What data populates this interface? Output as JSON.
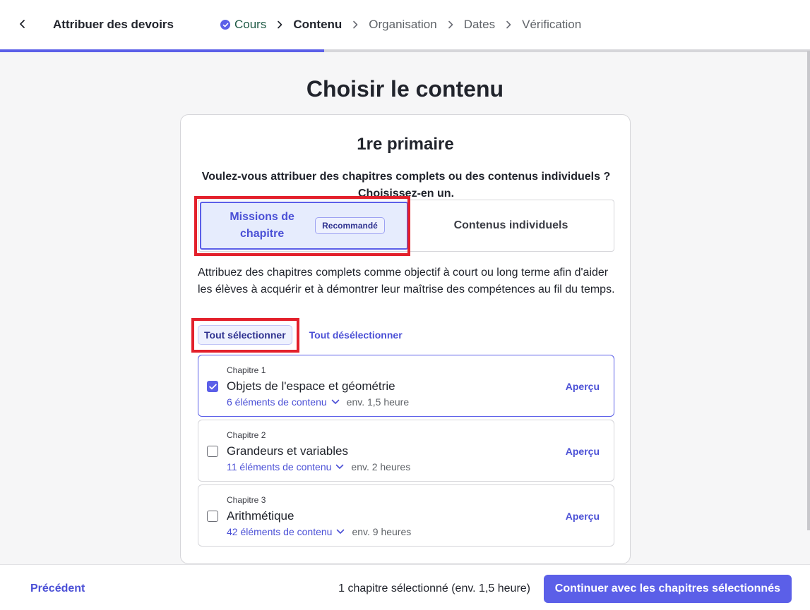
{
  "header": {
    "title": "Attribuer des devoirs",
    "steps": [
      {
        "label": "Cours",
        "state": "done"
      },
      {
        "label": "Contenu",
        "state": "current"
      },
      {
        "label": "Organisation",
        "state": "upcoming"
      },
      {
        "label": "Dates",
        "state": "upcoming"
      },
      {
        "label": "Vérification",
        "state": "upcoming"
      }
    ],
    "progress_fraction": 0.4
  },
  "page": {
    "title": "Choisir le contenu"
  },
  "card": {
    "course": "1re primaire",
    "question": "Voulez-vous attribuer des chapitres complets ou des contenus individuels ? Choisissez-en un.",
    "options": {
      "missions": "Missions de chapitre",
      "recommended_badge": "Recommandé",
      "individual": "Contenus individuels"
    },
    "description": "Attribuez des chapitres complets comme objectif à court ou long terme afin d'aider les élèves à acquérir et à démontrer leur maîtrise des compétences au fil du temps.",
    "select_all": "Tout sélectionner",
    "deselect_all": "Tout désélectionner",
    "chapters": [
      {
        "number": "Chapitre 1",
        "title": "Objets de l'espace et géométrie",
        "items": "6 éléments de contenu",
        "time": "env. 1,5 heure",
        "preview": "Aperçu",
        "checked": true
      },
      {
        "number": "Chapitre 2",
        "title": "Grandeurs et variables",
        "items": "11 éléments de contenu",
        "time": "env. 2 heures",
        "preview": "Aperçu",
        "checked": false
      },
      {
        "number": "Chapitre 3",
        "title": "Arithmétique",
        "items": "42 éléments de contenu",
        "time": "env. 9 heures",
        "preview": "Aperçu",
        "checked": false
      }
    ]
  },
  "footer": {
    "previous": "Précédent",
    "status": "1 chapitre sélectionné (env. 1,5 heure)",
    "continue": "Continuer avec les chapitres sélectionnés"
  },
  "colors": {
    "accent": "#5b5fe8",
    "highlight": "#e3202b",
    "done_step": "#1f5a45"
  },
  "icons": [
    "chevron-left-icon",
    "check-circle-icon",
    "chevron-right-icon",
    "checkbox-check-icon",
    "chevron-down-icon"
  ]
}
